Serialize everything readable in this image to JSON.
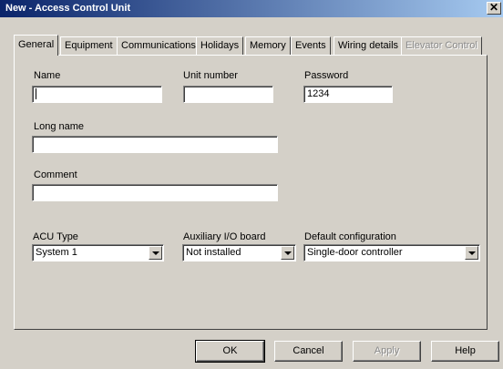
{
  "window": {
    "title": "New - Access Control Unit",
    "close_symbol": "✕"
  },
  "tabs": [
    {
      "label": "General",
      "active": true,
      "enabled": true
    },
    {
      "label": "Equipment",
      "active": false,
      "enabled": true
    },
    {
      "label": "Communications",
      "active": false,
      "enabled": true
    },
    {
      "label": "Holidays",
      "active": false,
      "enabled": true
    },
    {
      "label": "Memory",
      "active": false,
      "enabled": true
    },
    {
      "label": "Events",
      "active": false,
      "enabled": true
    },
    {
      "label": "Wiring details",
      "active": false,
      "enabled": true
    },
    {
      "label": "Elevator Control",
      "active": false,
      "enabled": false
    }
  ],
  "form": {
    "name_label": "Name",
    "name_value": "",
    "unit_number_label": "Unit number",
    "unit_number_value": "",
    "password_label": "Password",
    "password_value": "1234",
    "long_name_label": "Long name",
    "long_name_value": "",
    "comment_label": "Comment",
    "comment_value": "",
    "acu_type_label": "ACU Type",
    "acu_type_value": "System 1",
    "aux_board_label": "Auxiliary I/O board",
    "aux_board_value": "Not installed",
    "default_config_label": "Default configuration",
    "default_config_value": "Single-door controller"
  },
  "buttons": {
    "ok": "OK",
    "cancel": "Cancel",
    "apply": "Apply",
    "help": "Help"
  },
  "colors": {
    "titlebar_start": "#0a246a",
    "titlebar_end": "#a6caf0",
    "face": "#d4d0c8"
  }
}
